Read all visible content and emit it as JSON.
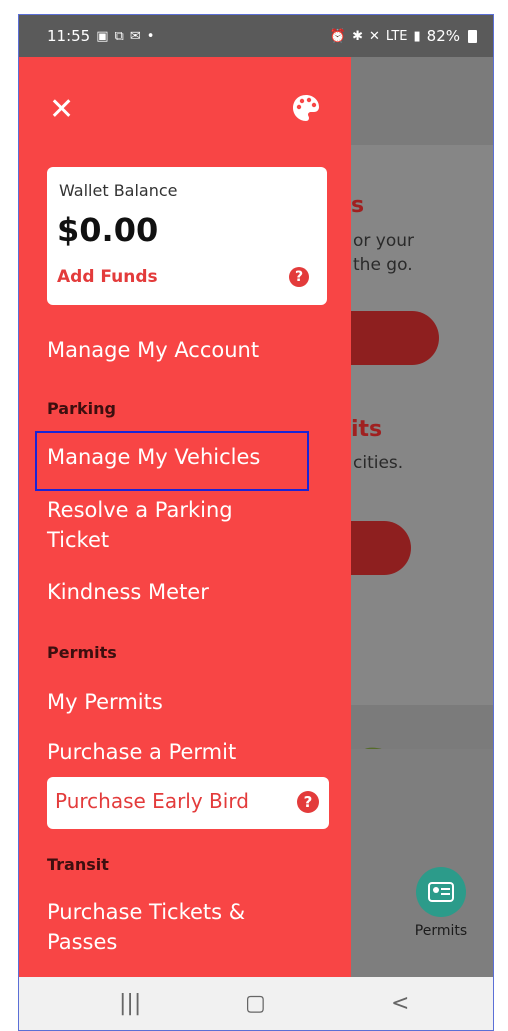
{
  "status_bar": {
    "time": "11:55",
    "left_icons": [
      "image-icon",
      "cast-icon",
      "mail-icon",
      "•"
    ],
    "right_icons": [
      "alarm-icon",
      "bluetooth-icon",
      "mute-icon",
      "LTE",
      "signal-icon"
    ],
    "battery": "82%"
  },
  "background": {
    "title_1": "s",
    "text_1a": "or your",
    "text_1b": "the go.",
    "title_2": "its",
    "text_2": "cities.",
    "permits_tab_label": "Permits"
  },
  "drawer": {
    "wallet": {
      "label": "Wallet Balance",
      "amount": "$0.00",
      "add_funds": "Add Funds",
      "help": "?"
    },
    "manage_account": "Manage My Account",
    "section_parking": "Parking",
    "manage_vehicles": "Manage My Vehicles",
    "resolve_ticket": "Resolve a Parking Ticket",
    "kindness_meter": "Kindness Meter",
    "section_permits": "Permits",
    "my_permits": "My Permits",
    "purchase_permit": "Purchase a Permit",
    "purchase_early_bird": "Purchase Early Bird",
    "early_bird_help": "?",
    "section_transit": "Transit",
    "purchase_tickets": "Purchase Tickets & Passes"
  },
  "system_nav": {
    "recents": "|||",
    "home": "▢",
    "back": "<"
  },
  "colors": {
    "drawer_bg": "#f84545",
    "accent_red": "#e33b3b",
    "highlight": "#1a24d6",
    "teal": "#2c9b8a"
  }
}
